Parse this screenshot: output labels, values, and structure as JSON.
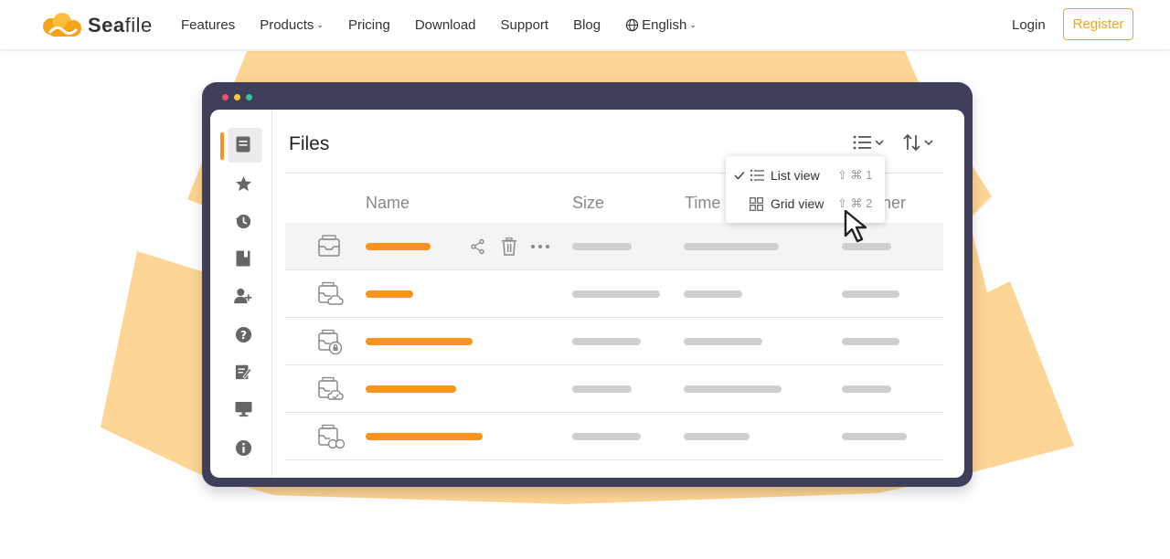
{
  "header": {
    "logo_text_bold": "Sea",
    "logo_text_rest": "file",
    "nav": [
      "Features",
      "Products",
      "Pricing",
      "Download",
      "Support",
      "Blog",
      "English"
    ],
    "login": "Login",
    "register": "Register"
  },
  "app": {
    "title": "Files",
    "columns": [
      "Name",
      "Size",
      "Time",
      "ner"
    ],
    "view_menu": {
      "items": [
        {
          "label": "List view",
          "shortcut": "⇧ ⌘ 1",
          "checked": true
        },
        {
          "label": "Grid view",
          "shortcut": "⇧ ⌘ 2",
          "checked": false
        }
      ]
    }
  },
  "colors": {
    "accent": "#f7a31a",
    "orange_bar": "#f7931e",
    "window_frame": "#3f3f5c",
    "background_shape": "#fdd594"
  }
}
